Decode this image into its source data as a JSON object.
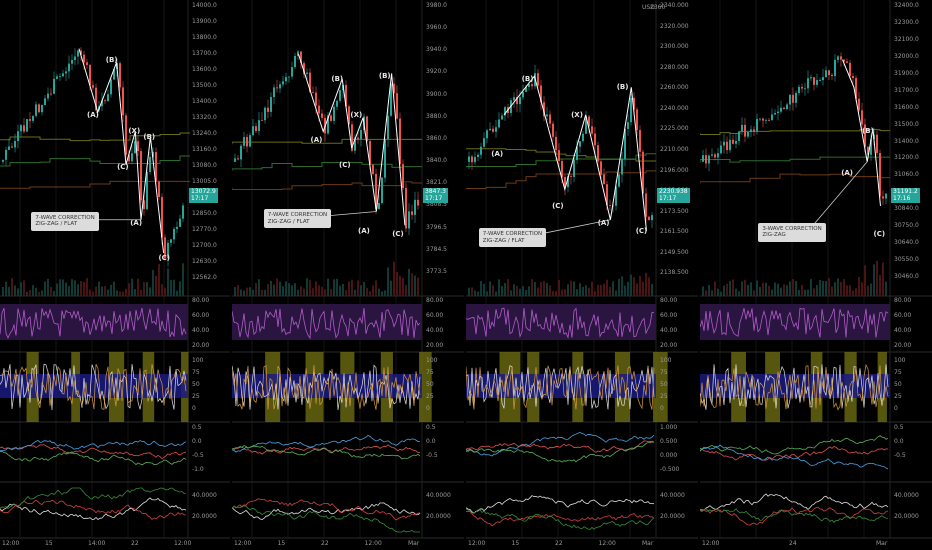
{
  "panels": [
    {
      "id": "p1",
      "price_ticks": [
        "14000.0",
        "13900.0",
        "13800.0",
        "13700.0",
        "13600.0",
        "13500.0",
        "13400.0",
        "13320.0",
        "13240.0",
        "13160.0",
        "13080.0",
        "13005.0",
        "12930.0",
        "12850.0",
        "12770.0",
        "12700.0",
        "12630.0",
        "12562.0"
      ],
      "last_price": "13072.9\n17:17",
      "rsi_ticks": [
        "80.00",
        "60.00",
        "40.00",
        "20.00"
      ],
      "stoch_ticks": [
        "100",
        "75",
        "50",
        "25",
        "0"
      ],
      "macd_ticks": [
        "0.5",
        "0.0",
        "-0.5",
        "-1.0"
      ],
      "adx_ticks": [
        "40.0000",
        "20.0000"
      ],
      "time_labels": [
        "12:00",
        "15",
        "14:00",
        "22",
        "12:00"
      ],
      "callout": "7-WAVE CORRECTION\nZIG-ZAG / FLAT",
      "wave_labels": [
        "(A)",
        "(B)",
        "(C)",
        "(X)",
        "(A)",
        "(B)",
        "(C)"
      ]
    },
    {
      "id": "p2",
      "price_ticks": [
        "3980.0",
        "3960.0",
        "3940.0",
        "3920.0",
        "3900.0",
        "3880.0",
        "3860.0",
        "3840.0",
        "3821.0",
        "3808.5",
        "3796.5",
        "3784.5",
        "3773.5"
      ],
      "last_price": "3847.3\n17:17",
      "rsi_ticks": [
        "80.00",
        "60.00",
        "40.00",
        "20.00"
      ],
      "stoch_ticks": [
        "100",
        "75",
        "50",
        "25",
        "0"
      ],
      "macd_ticks": [
        "0.5",
        "0.0",
        "-0.5"
      ],
      "adx_ticks": [
        "40.0000",
        "20.0000"
      ],
      "time_labels": [
        "12:00",
        "15",
        "22",
        "12:00",
        "Mar"
      ],
      "callout": "7-WAVE CORRECTION\nZIG-ZAG / FLAT",
      "wave_labels": [
        "(A)",
        "(B)",
        "(C)",
        "(X)",
        "(A)",
        "(B)",
        "(C)"
      ]
    },
    {
      "id": "p3",
      "price_ticks": [
        "2340.000",
        "2320.000",
        "2300.000",
        "2280.000",
        "2260.000",
        "2240.000",
        "2225.000",
        "2210.000",
        "2196.000",
        "2185.000",
        "2173.500",
        "2161.500",
        "2149.500",
        "2138.500"
      ],
      "last_price": "2230.938\n17:17",
      "currency": "USD",
      "top_tick": "2360",
      "rsi_ticks": [
        "80.00",
        "60.00",
        "40.00",
        "20.00"
      ],
      "stoch_ticks": [
        "100",
        "75",
        "50",
        "25",
        "0"
      ],
      "macd_ticks": [
        "1.000",
        "0.500",
        "0.000",
        "-0.500"
      ],
      "adx_ticks": [
        "40.0000",
        "20.0000"
      ],
      "time_labels": [
        "12:00",
        "15",
        "22",
        "12:00",
        "Mar"
      ],
      "callout": "7-WAVE CORRECTION\nZIG-ZAG / FLAT",
      "wave_labels": [
        "(A)",
        "(B)",
        "(C)",
        "(X)",
        "(A)",
        "(B)",
        "(C)"
      ]
    },
    {
      "id": "p4",
      "price_ticks": [
        "32400.0",
        "32300.0",
        "32100.0",
        "32000.0",
        "31900.0",
        "31700.0",
        "31600.0",
        "31500.0",
        "31400.0",
        "31200.0",
        "31060.0",
        "30940.0",
        "30840.0",
        "30750.0",
        "30640.0",
        "30550.0",
        "30460.0"
      ],
      "last_price": "31191.2\n17:16",
      "rsi_ticks": [
        "80.00",
        "60.00",
        "40.00",
        "20.00"
      ],
      "stoch_ticks": [
        "100",
        "75",
        "50",
        "25",
        "0"
      ],
      "macd_ticks": [
        "0.5",
        "0.0",
        "-0.5"
      ],
      "adx_ticks": [
        "40.0000",
        "20.0000"
      ],
      "time_labels": [
        "12:00",
        "24",
        "Mar"
      ],
      "callout": "3-WAVE CORRECTION\nZIG-ZAG",
      "wave_labels": [
        "(A)",
        "(B)",
        "(C)"
      ]
    }
  ],
  "colors": {
    "bg": "#000000",
    "up": "#26a69a",
    "down": "#ef5350",
    "rsi_line": "#b05cc8",
    "rsi_band": "#2a1540",
    "stoch_band": "#1a1a80",
    "stoch_highlight": "#6b6b12",
    "wave_line": "#ffffff",
    "grid": "#151515",
    "axis_text": "#9a9a9a"
  }
}
